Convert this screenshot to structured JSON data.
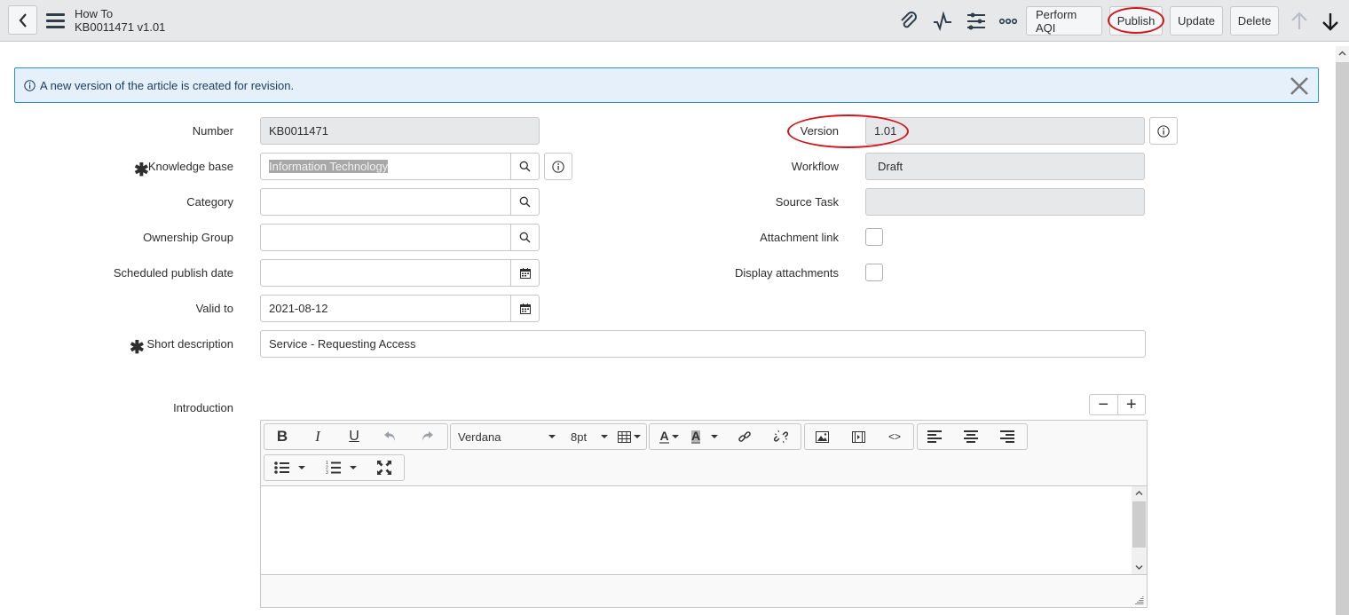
{
  "header": {
    "title": "How To",
    "subtitle": "KB0011471 v1.01",
    "icons": [
      "paperclip-icon",
      "activity-icon",
      "settings-sliders-icon",
      "more-options-icon"
    ],
    "buttons": {
      "perform_aqi": "Perform AQI",
      "publish": "Publish",
      "update": "Update",
      "delete": "Delete"
    }
  },
  "banner": {
    "message": "A new version of the article is created for revision."
  },
  "form": {
    "left": {
      "number": {
        "label": "Number",
        "value": "KB0011471"
      },
      "knowledge_base": {
        "label": "Knowledge base",
        "value": "Information Technology",
        "required": true
      },
      "category": {
        "label": "Category",
        "value": ""
      },
      "ownership_group": {
        "label": "Ownership Group",
        "value": ""
      },
      "scheduled_publish_date": {
        "label": "Scheduled publish date",
        "value": ""
      },
      "valid_to": {
        "label": "Valid to",
        "value": "2021-08-12"
      },
      "short_description": {
        "label": "Short description",
        "value": "Service - Requesting Access",
        "required": true
      }
    },
    "right": {
      "version": {
        "label": "Version",
        "value": "1.01"
      },
      "workflow": {
        "label": "Workflow",
        "value": "Draft"
      },
      "source_task": {
        "label": "Source Task",
        "value": ""
      },
      "attachment_link": {
        "label": "Attachment link",
        "checked": false
      },
      "display_attachments": {
        "label": "Display attachments",
        "checked": false
      }
    },
    "required_marker": "✱"
  },
  "introduction": {
    "label": "Introduction",
    "zoom_out": "−",
    "zoom_in": "+",
    "toolbar": {
      "bold": "B",
      "italic": "I",
      "underline": "U",
      "font_family": "Verdana",
      "font_size": "8pt",
      "text_color": "A",
      "bg_color": "A",
      "code": "<>"
    },
    "content": ""
  }
}
